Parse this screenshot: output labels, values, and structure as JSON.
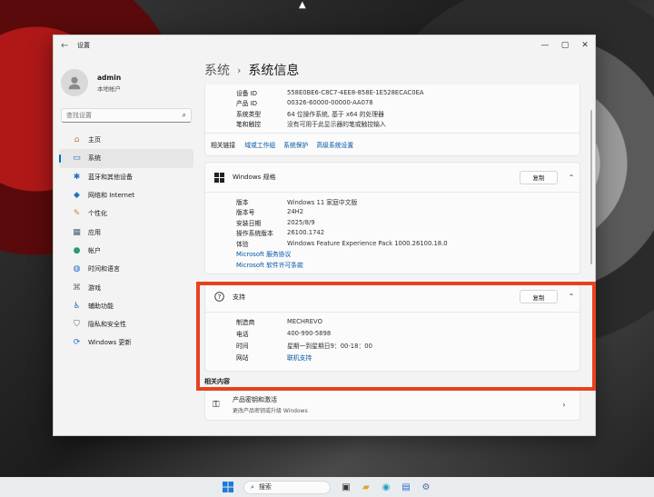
{
  "window": {
    "title": "设置"
  },
  "account": {
    "name": "admin",
    "type": "本地帐户"
  },
  "search": {
    "placeholder": "查找设置"
  },
  "nav": [
    {
      "label": "主页",
      "icon": "home-icon"
    },
    {
      "label": "系统",
      "icon": "system-icon",
      "active": true
    },
    {
      "label": "蓝牙和其他设备",
      "icon": "bluetooth-icon"
    },
    {
      "label": "网络和 Internet",
      "icon": "network-icon"
    },
    {
      "label": "个性化",
      "icon": "brush-icon"
    },
    {
      "label": "应用",
      "icon": "apps-icon"
    },
    {
      "label": "帐户",
      "icon": "account-icon"
    },
    {
      "label": "时间和语言",
      "icon": "globe-clock-icon"
    },
    {
      "label": "游戏",
      "icon": "gamepad-icon"
    },
    {
      "label": "辅助功能",
      "icon": "accessibility-icon"
    },
    {
      "label": "隐私和安全性",
      "icon": "shield-icon"
    },
    {
      "label": "Windows 更新",
      "icon": "update-icon"
    }
  ],
  "breadcrumb": {
    "parent": "系统",
    "separator": "›",
    "current": "系统信息"
  },
  "device_spec": {
    "rows": [
      {
        "k": "设备 ID",
        "v": "558E0BE6-C8C7-4EE8-858E-1E528ECAC0EA"
      },
      {
        "k": "产品 ID",
        "v": "00326-60000-00000-AA078"
      },
      {
        "k": "系统类型",
        "v": "64 位操作系统, 基于 x64 的处理器"
      },
      {
        "k": "笔和触控",
        "v": "没有可用于此显示器的笔或触控输入"
      }
    ]
  },
  "related_links": {
    "label": "相关链接",
    "links": [
      "域或工作组",
      "系统保护",
      "高级系统设置"
    ]
  },
  "windows_spec": {
    "title": "Windows 规格",
    "copy": "复制",
    "rows": [
      {
        "k": "版本",
        "v": "Windows 11 家庭中文版"
      },
      {
        "k": "版本号",
        "v": "24H2"
      },
      {
        "k": "安装日期",
        "v": "2025/8/9"
      },
      {
        "k": "操作系统版本",
        "v": "26100.1742"
      },
      {
        "k": "体验",
        "v": "Windows Feature Experience Pack 1000.26100.18.0"
      }
    ],
    "links": [
      "Microsoft 服务协议",
      "Microsoft 软件许可条款"
    ]
  },
  "support": {
    "title": "支持",
    "copy": "复制",
    "rows": [
      {
        "k": "制造商",
        "v": "MECHREVO"
      },
      {
        "k": "电话",
        "v": "400-990-5898"
      },
      {
        "k": "时间",
        "v": "星期一到星期日9：00-18：00"
      }
    ],
    "website": {
      "k": "网站",
      "v": "联机支持"
    }
  },
  "related_content": {
    "title": "相关内容",
    "item_title": "产品密钥和激活",
    "item_desc": "更改产品密钥或升级 Windows"
  },
  "taskbar": {
    "search": "搜索"
  },
  "colors": {
    "highlight": "#e8411f",
    "accent": "#0067c0",
    "link": "#0055a5"
  }
}
